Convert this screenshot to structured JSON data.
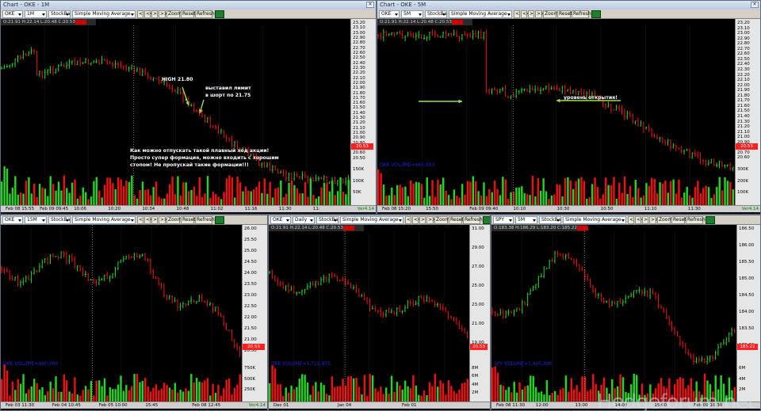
{
  "windows": [
    {
      "title": "Chart - OKE - 1M",
      "symbol": "OKE",
      "interval": "1M",
      "bartype": "StockBar",
      "indicator": "Simple Moving Average",
      "buttons": [
        "<",
        "<<",
        ">",
        ">>",
        "Zoom",
        "Reset",
        "Refresh"
      ],
      "ohlc": "O:21.91  H:22.14  L:20.48  C:20.53",
      "chg": "",
      "price_tag": "20.53",
      "ver": "Ver4.14",
      "vol": "",
      "xlabels": [
        "Feb 08 15:55",
        "Feb 09 09:45",
        "10:06",
        "10:20",
        "10:34",
        "10:48",
        "11:02",
        "11:16",
        "11:30",
        "11:"
      ],
      "ylabels": [
        "23.20",
        "23.10",
        "23.00",
        "22.90",
        "22.80",
        "22.70",
        "22.60",
        "22.50",
        "22.40",
        "22.30",
        "22.20",
        "22.10",
        "22.00",
        "21.90",
        "21.80",
        "21.70",
        "21.60",
        "21.50",
        "21.40",
        "21.30",
        "21.20",
        "21.10",
        "21.00",
        "20.90",
        "20.80",
        "20.70",
        "20.60",
        "20.50"
      ],
      "vlabels": [
        "150K",
        "100K",
        "50K"
      ],
      "annotations": [
        "HIGH 21.80",
        "выставил лимит",
        "в шорт по 21.75",
        "Как можно отпускать такой плавный ход акции!",
        "Просто супер формация, можно входить с хорошим",
        "стопом! Не пропускай такие формации!!!"
      ]
    },
    {
      "title": "Chart - OKE - 5M",
      "symbol": "OKE",
      "interval": "5M",
      "bartype": "StockBar",
      "indicator": "Simple Moving Average",
      "buttons": [
        "<",
        "<<",
        ">",
        ">>",
        "Zoom",
        "Reset",
        "Refresh"
      ],
      "ohlc": "O:21.91  H:22.14  L:20.48  C:20.53",
      "chg": "",
      "price_tag": "20.53",
      "ver": "Ver4.14",
      "vol": "OKE VOLUME=460,003",
      "xlabels": [
        "Feb 08 15:20",
        "15:50",
        "Feb 09 09:40",
        "10:10",
        "10:30",
        "10:50",
        "11:10",
        "11:30"
      ],
      "ylabels": [
        "23.20",
        "23.10",
        "23.00",
        "22.90",
        "22.80",
        "22.70",
        "22.60",
        "22.50",
        "22.40",
        "22.30",
        "22.20",
        "22.10",
        "22.00",
        "21.90",
        "21.80",
        "21.70",
        "21.60",
        "21.50",
        "21.40",
        "21.30",
        "21.20",
        "21.10",
        "21.00",
        "20.90",
        "20.80",
        "20.70",
        "20.60"
      ],
      "vlabels": [
        "300K",
        "200K",
        "100K"
      ],
      "annotations": [
        "уровень открытия!"
      ]
    },
    {
      "title": "",
      "symbol": "OKE",
      "interval": "15M",
      "bartype": "StockBar",
      "indicator": "Simple Moving Average",
      "buttons": [
        "<",
        "<<",
        ">",
        ">>",
        "Zoom",
        "Reset",
        "Refresh"
      ],
      "ohlc": "",
      "chg": "",
      "price_tag": "20.53",
      "ver": "Ver4.14",
      "vol": "OKE VOLUME=460,003",
      "xlabels": [
        "Feb 03 11:30",
        "Feb 04 10:45",
        "Feb 05 10:00",
        "15:45",
        "Feb 08 12:45"
      ],
      "ylabels": [
        "26.00",
        "25.50",
        "25.00",
        "24.50",
        "24.00",
        "23.50",
        "23.00",
        "22.50",
        "22.00",
        "21.50",
        "21.00",
        "20.50"
      ],
      "vlabels": [
        "750K",
        "500K",
        "250K"
      ],
      "annotations": []
    },
    {
      "title": "",
      "symbol": "OKE",
      "interval": "Daily",
      "bartype": "StockBar",
      "indicator": "Simple Moving Average",
      "buttons": [
        "<",
        "<<",
        ">",
        ">>",
        "Zoom",
        "Reset",
        "Refresh"
      ],
      "ohlc": "O:21.91  H:22.14  L:20.48  C:20.53",
      "chg": "",
      "price_tag": "20.53",
      "ver": "",
      "vol": "OKE VOLUME=1,722,975",
      "xlabels": [
        "Dec 01",
        "Jan 04",
        "Feb 01"
      ],
      "ylabels": [
        "31.00",
        "29.00",
        "27.00",
        "25.00",
        "23.00",
        "21.00",
        "19.00"
      ],
      "vlabels": [
        "8M",
        "6M",
        "4M",
        "2M"
      ],
      "annotations": []
    },
    {
      "title": "",
      "symbol": "SPY",
      "interval": "5M",
      "bartype": "StockBar",
      "indicator": "Simple Moving Average",
      "buttons": [
        "<",
        "<<",
        ">",
        ">>",
        "Zoom",
        "Reset",
        "Refresh"
      ],
      "ohlc": "O:183.38  H:186.29  L:183.20  C:185.22",
      "chg": "",
      "price_tag": "185.22",
      "ver": "",
      "vol": "SPY VOLUME=1,445,800",
      "xlabels": [
        "Feb 08 11:30",
        "12:00",
        "13:00",
        "14:00",
        "15:00",
        "Feb 09 10:30"
      ],
      "ylabels": [
        "186.50",
        "186.00",
        "185.50",
        "185.00",
        "184.50",
        "184.00",
        "183.50",
        "183.00"
      ],
      "vlabels": [
        "6M",
        "4M",
        "2M"
      ],
      "annotations": []
    }
  ],
  "watermark": "Hedgeforum.net",
  "colors": {
    "up": "#22d622",
    "down": "#e11",
    "grid": "#444",
    "bg": "#000"
  }
}
